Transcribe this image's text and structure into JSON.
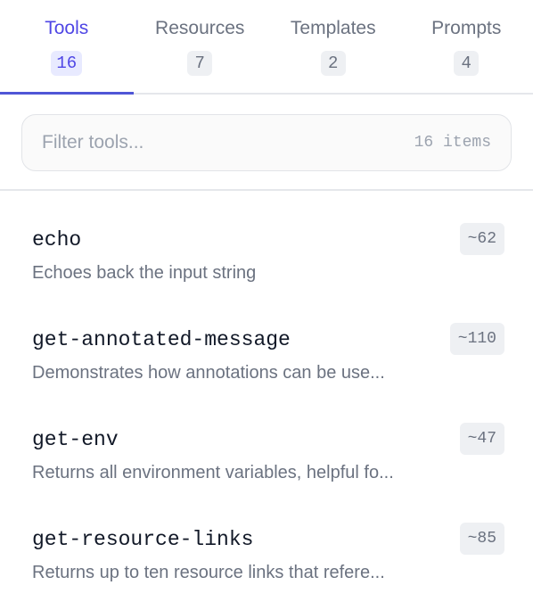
{
  "tabs": [
    {
      "label": "Tools",
      "count": "16",
      "active": true
    },
    {
      "label": "Resources",
      "count": "7",
      "active": false
    },
    {
      "label": "Templates",
      "count": "2",
      "active": false
    },
    {
      "label": "Prompts",
      "count": "4",
      "active": false
    }
  ],
  "filter": {
    "placeholder": "Filter tools...",
    "value": "",
    "count_label": "16 items"
  },
  "items": [
    {
      "name": "echo",
      "description": "Echoes back the input string",
      "tokens": "~62"
    },
    {
      "name": "get-annotated-message",
      "description": "Demonstrates how annotations can be use...",
      "tokens": "~110"
    },
    {
      "name": "get-env",
      "description": "Returns all environment variables, helpful fo...",
      "tokens": "~47"
    },
    {
      "name": "get-resource-links",
      "description": "Returns up to ten resource links that refere...",
      "tokens": "~85"
    }
  ],
  "colors": {
    "accent": "#4f46e5",
    "muted_text": "#6b7280",
    "badge_bg": "#eef0f3",
    "active_badge_bg": "#e8eaff"
  }
}
